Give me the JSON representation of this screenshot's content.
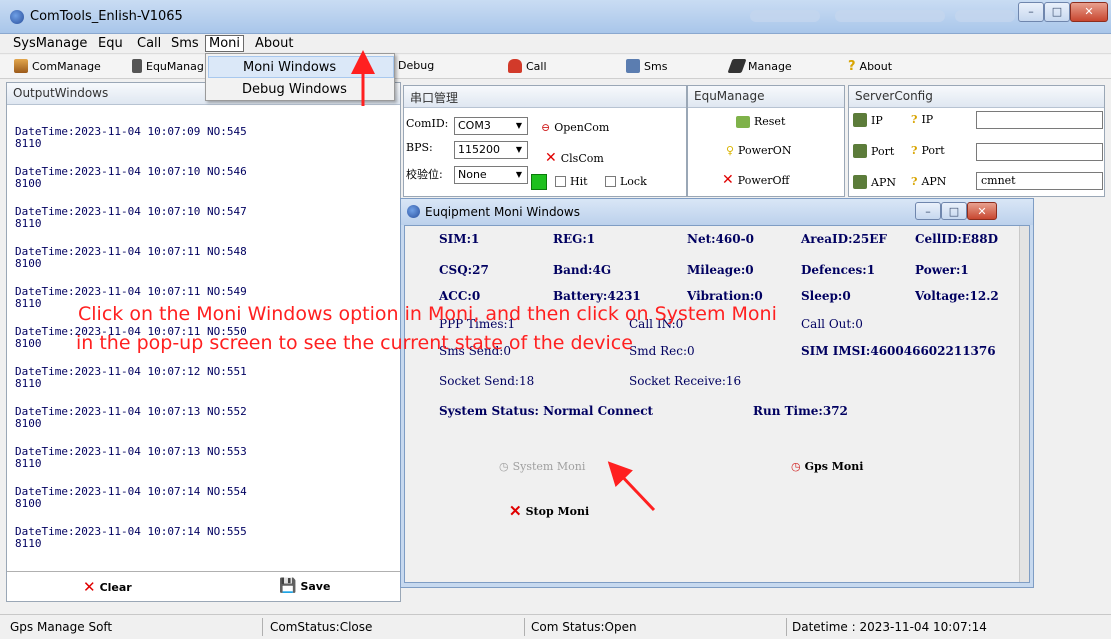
{
  "window": {
    "title": "ComTools_Enlish-V1065"
  },
  "menubar": {
    "items": [
      "SysManage",
      "Equ",
      "Call",
      "Sms",
      "Moni",
      "About"
    ]
  },
  "popup_menu": {
    "items": [
      "Moni Windows",
      "Debug Windows"
    ]
  },
  "toolbar": {
    "items": [
      "ComManage",
      "EquManag",
      "Debug",
      "Call",
      "Sms",
      "Manage",
      "About"
    ]
  },
  "output_window": {
    "title": "OutputWindows",
    "entries": [
      {
        "datetime": "DateTime:2023-11-04 10:07:09",
        "no": "NO:545",
        "value": "8110"
      },
      {
        "datetime": "DateTime:2023-11-04 10:07:10",
        "no": "NO:546",
        "value": "8100"
      },
      {
        "datetime": "DateTime:2023-11-04 10:07:10",
        "no": "NO:547",
        "value": "8110"
      },
      {
        "datetime": "DateTime:2023-11-04 10:07:11",
        "no": "NO:548",
        "value": "8100"
      },
      {
        "datetime": "DateTime:2023-11-04 10:07:11",
        "no": "NO:549",
        "value": "8110"
      },
      {
        "datetime": "DateTime:2023-11-04 10:07:11",
        "no": "NO:550",
        "value": "8100"
      },
      {
        "datetime": "DateTime:2023-11-04 10:07:12",
        "no": "NO:551",
        "value": "8110"
      },
      {
        "datetime": "DateTime:2023-11-04 10:07:13",
        "no": "NO:552",
        "value": "8100"
      },
      {
        "datetime": "DateTime:2023-11-04 10:07:13",
        "no": "NO:553",
        "value": "8110"
      },
      {
        "datetime": "DateTime:2023-11-04 10:07:14",
        "no": "NO:554",
        "value": "8100"
      },
      {
        "datetime": "DateTime:2023-11-04 10:07:14",
        "no": "NO:555",
        "value": "8110"
      }
    ],
    "clear_label": "Clear",
    "save_label": "Save"
  },
  "serial_panel": {
    "title": "串口管理",
    "comid_label": "ComID:",
    "comid_value": "COM3",
    "bps_label": "BPS:",
    "bps_value": "115200",
    "parity_label": "校验位:",
    "parity_value": "None",
    "open_label": "OpenCom",
    "close_label": "ClsCom",
    "hit_label": "Hit",
    "lock_label": "Lock"
  },
  "equ_panel": {
    "title": "EquManage",
    "reset": "Reset",
    "power_on": "PowerON",
    "power_off": "PowerOff"
  },
  "server_panel": {
    "title": "ServerConfig",
    "ip_btn": "IP",
    "ip_label": "IP",
    "ip_value": "",
    "port_btn": "Port",
    "port_label": "Port",
    "port_value": "",
    "apn_btn": "APN",
    "apn_label": "APN",
    "apn_value": "cmnet"
  },
  "moni_window": {
    "title": "Euqipment Moni Windows",
    "row1": [
      "SIM:1",
      "REG:1",
      "Net:460-0",
      "AreaID:25EF",
      "CellID:E88D"
    ],
    "row2": [
      "CSQ:27",
      "Band:4G",
      "Mileage:0",
      "Defences:1",
      "Power:1"
    ],
    "row3": [
      "ACC:0",
      "Battery:4231",
      "Vibration:0",
      "Sleep:0",
      "Voltage:12.2"
    ],
    "ppp_times": "PPP Times:1",
    "call_in": "Call IN:0",
    "call_out": "Call Out:0",
    "sms_send": "Sms Send:0",
    "smd_rec": "Smd Rec:0",
    "sim_imsi": "SIM IMSI:460046602211376",
    "socket_send": "Socket Send:18",
    "socket_receive": "Socket Receive:16",
    "system_status": "System Status: Normal Connect",
    "run_time": "Run Time:372",
    "system_moni": "System Moni",
    "gps_moni": "Gps Moni",
    "stop_moni": "Stop Moni"
  },
  "annotation": {
    "line1": "Click on the Moni Windows option in Moni, and then click on System Moni",
    "line2": "in the pop-up screen to see the current state of the device"
  },
  "statusbar": {
    "app": "Gps Manage Soft",
    "com_status_close": "ComStatus:Close",
    "com_status_open": "Com Status:Open",
    "datetime": "Datetime : 2023-11-04 10:07:14"
  },
  "colors": {
    "accent": "#ff2020",
    "text_blue": "#000060"
  }
}
